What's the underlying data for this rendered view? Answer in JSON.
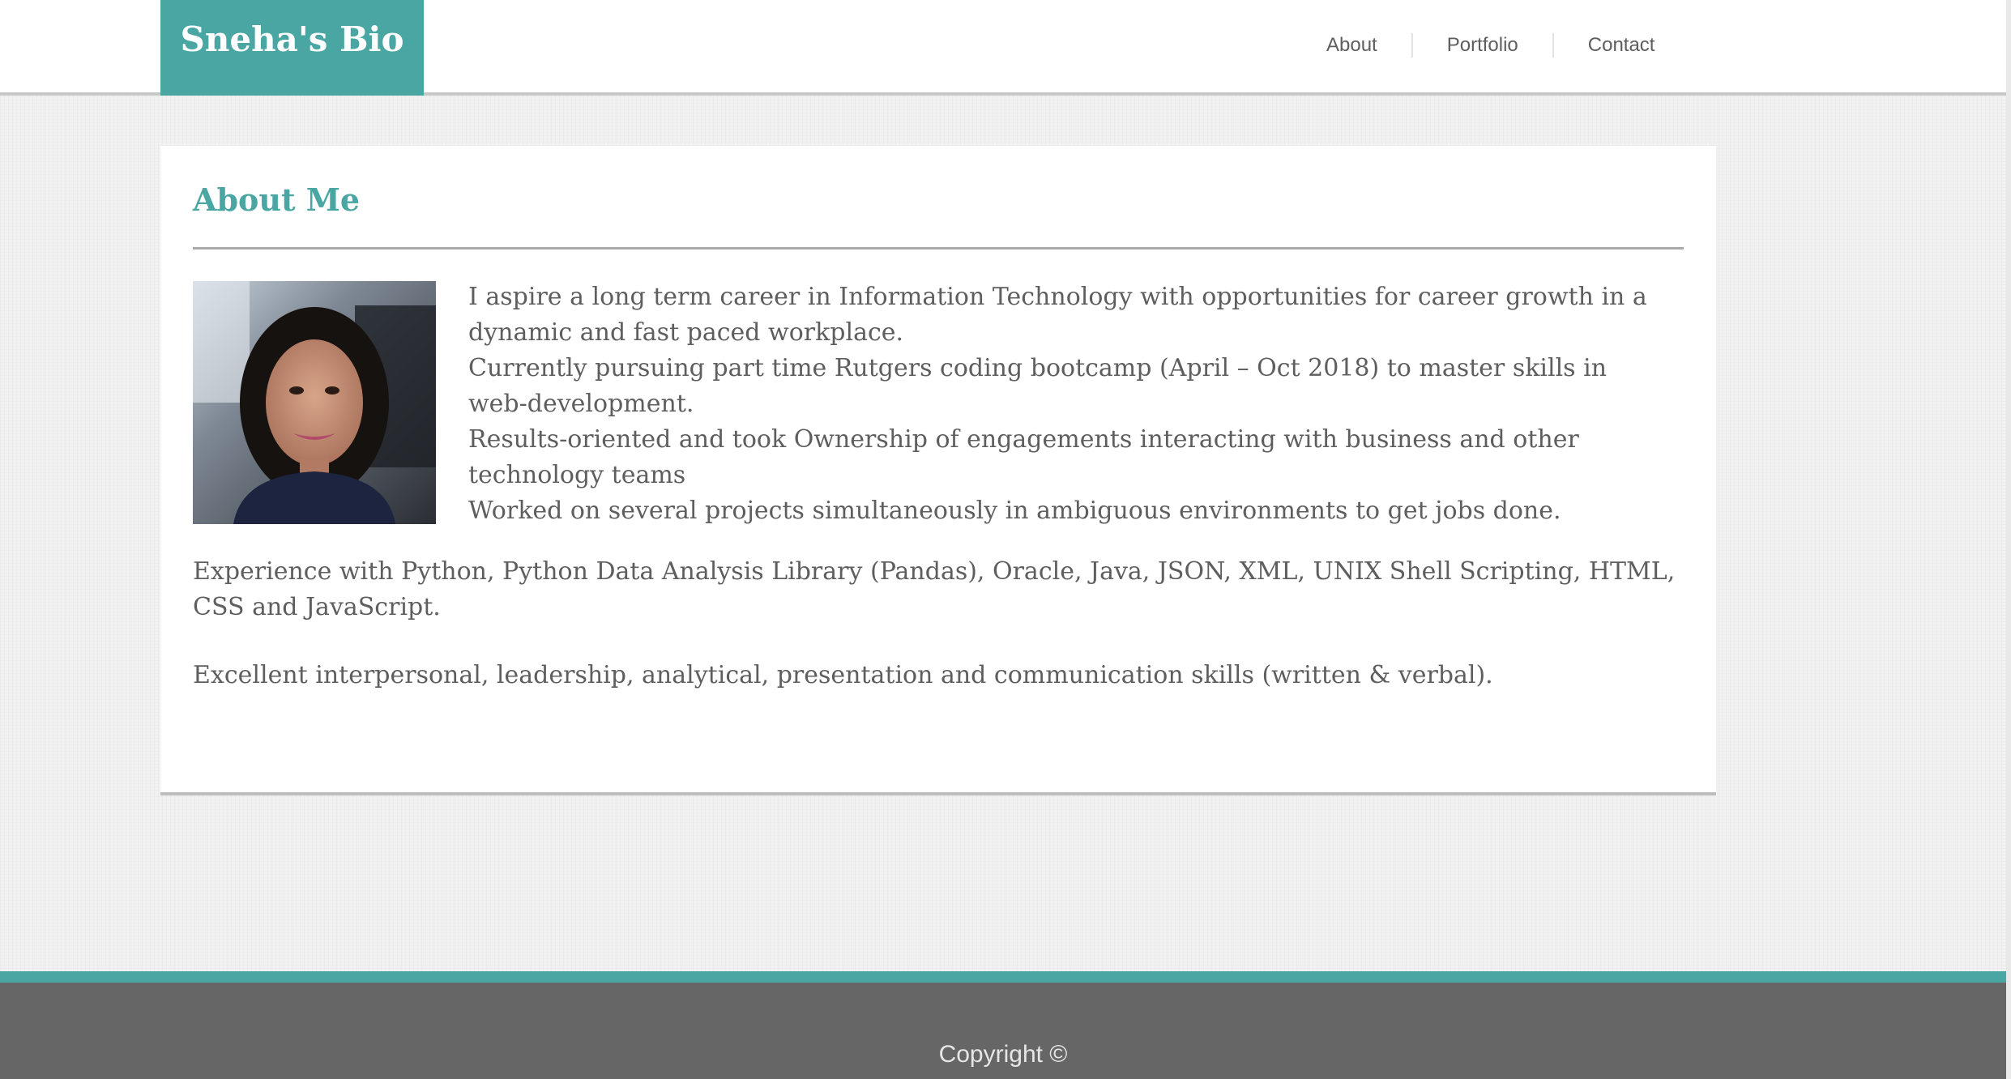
{
  "header": {
    "brand": "Sneha's Bio",
    "nav": [
      {
        "label": "About"
      },
      {
        "label": "Portfolio"
      },
      {
        "label": "Contact"
      }
    ]
  },
  "main": {
    "heading": "About Me",
    "photo_alt": "Profile photo",
    "bio_lines": [
      "I aspire a long term career in Information Technology with opportunities for career growth in a dynamic and fast paced workplace.",
      "Currently pursuing part time Rutgers coding bootcamp (April – Oct 2018) to master skills in web-development.",
      "Results-oriented and took Ownership of engagements interacting with business and other technology teams",
      "Worked on several projects simultaneously in ambiguous environments to get jobs done."
    ],
    "paragraphs": [
      "Experience with Python, Python Data Analysis Library (Pandas), Oracle, Java, JSON, XML, UNIX Shell Scripting, HTML, CSS and JavaScript.",
      "Excellent interpersonal, leadership, analytical, presentation and communication skills (written & verbal)."
    ]
  },
  "footer": {
    "copyright": "Copyright ©"
  },
  "colors": {
    "accent": "#4aa6a2",
    "text": "#5e5e5e",
    "footer_bg": "#666666"
  }
}
